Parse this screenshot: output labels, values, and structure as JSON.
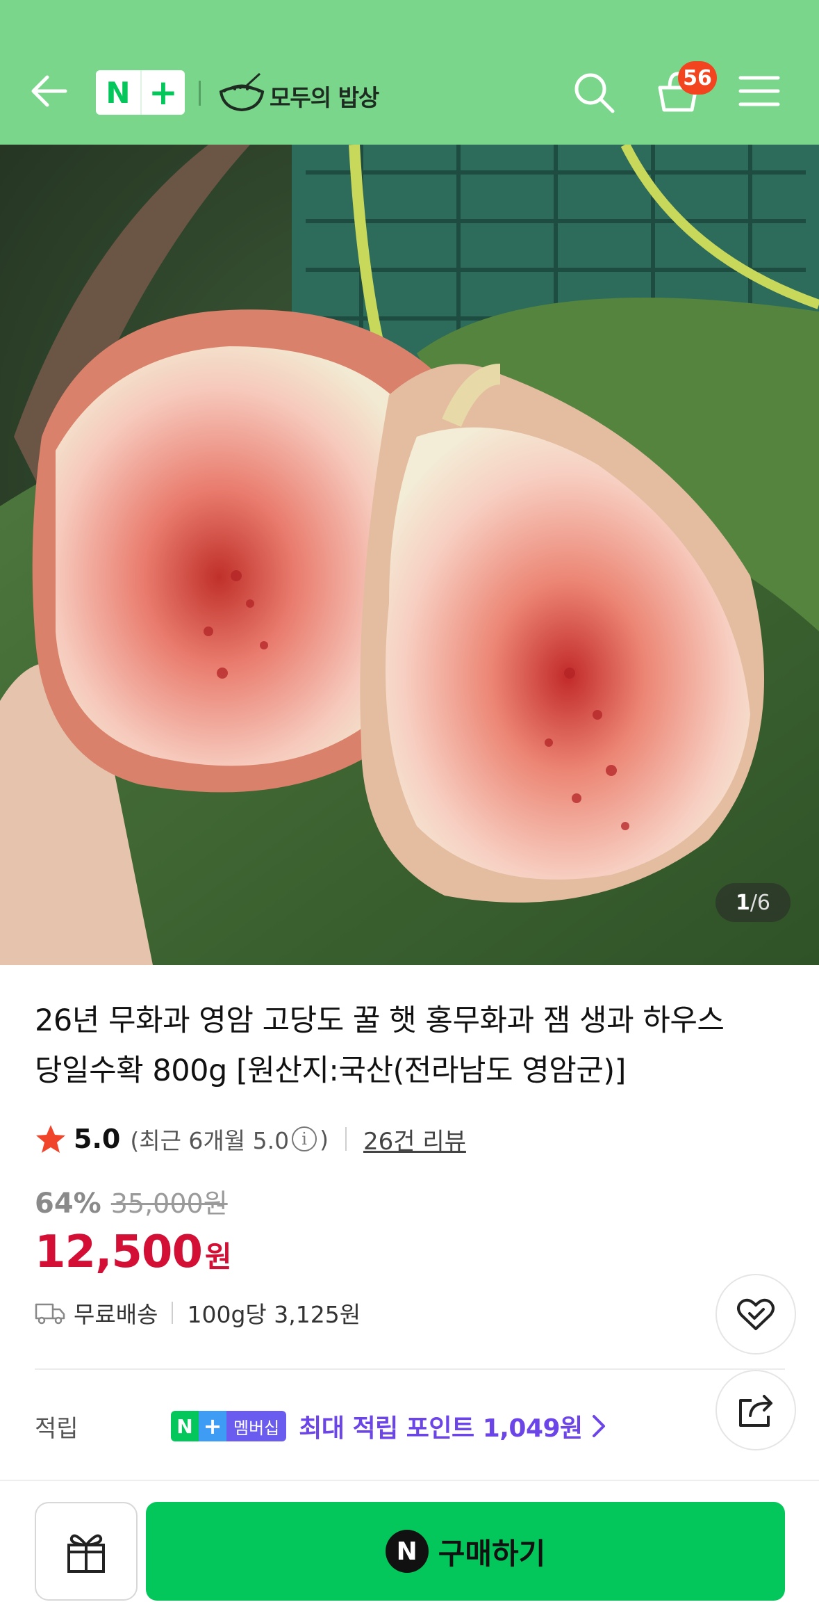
{
  "header": {
    "badge_n": "N",
    "badge_plus": "+",
    "brand": "모두의 밥상",
    "cart_count": "56",
    "accent": "#79d68a"
  },
  "gallery": {
    "current": "1",
    "total": "/6"
  },
  "product": {
    "title_line1": "26년 무화과 영암 고당도 꿀 햇 홍무화과 잼 생과 하우스",
    "title_line2": "당일수확 800g [원산지:국산(전라남도 영암군)]",
    "rating": "5.0",
    "recent_rating_prefix": "(최근 6개월 5.0",
    "recent_rating_suffix": ")",
    "reviews": "26건 리뷰",
    "discount": "64%",
    "original_price": "35,000원",
    "price": "12,500",
    "price_unit": "원",
    "price_color": "#d30f35",
    "shipping": "무료배송",
    "unit_price": "100g당 3,125원"
  },
  "points": {
    "label": "적립",
    "membership_n": "N",
    "membership_plus": "+",
    "membership_label": "멤버십",
    "text": "최대 적립 포인트 1,049원"
  },
  "bottom": {
    "buy_icon": "N",
    "buy_label": "구매하기",
    "buy_color": "#03c75a"
  },
  "icons": [
    "back-arrow-icon",
    "search-icon",
    "cart-icon",
    "menu-icon",
    "rice-bowl-icon",
    "star-icon",
    "info-icon",
    "truck-icon",
    "heart-check-icon",
    "share-icon",
    "chevron-right-icon",
    "gift-icon"
  ]
}
